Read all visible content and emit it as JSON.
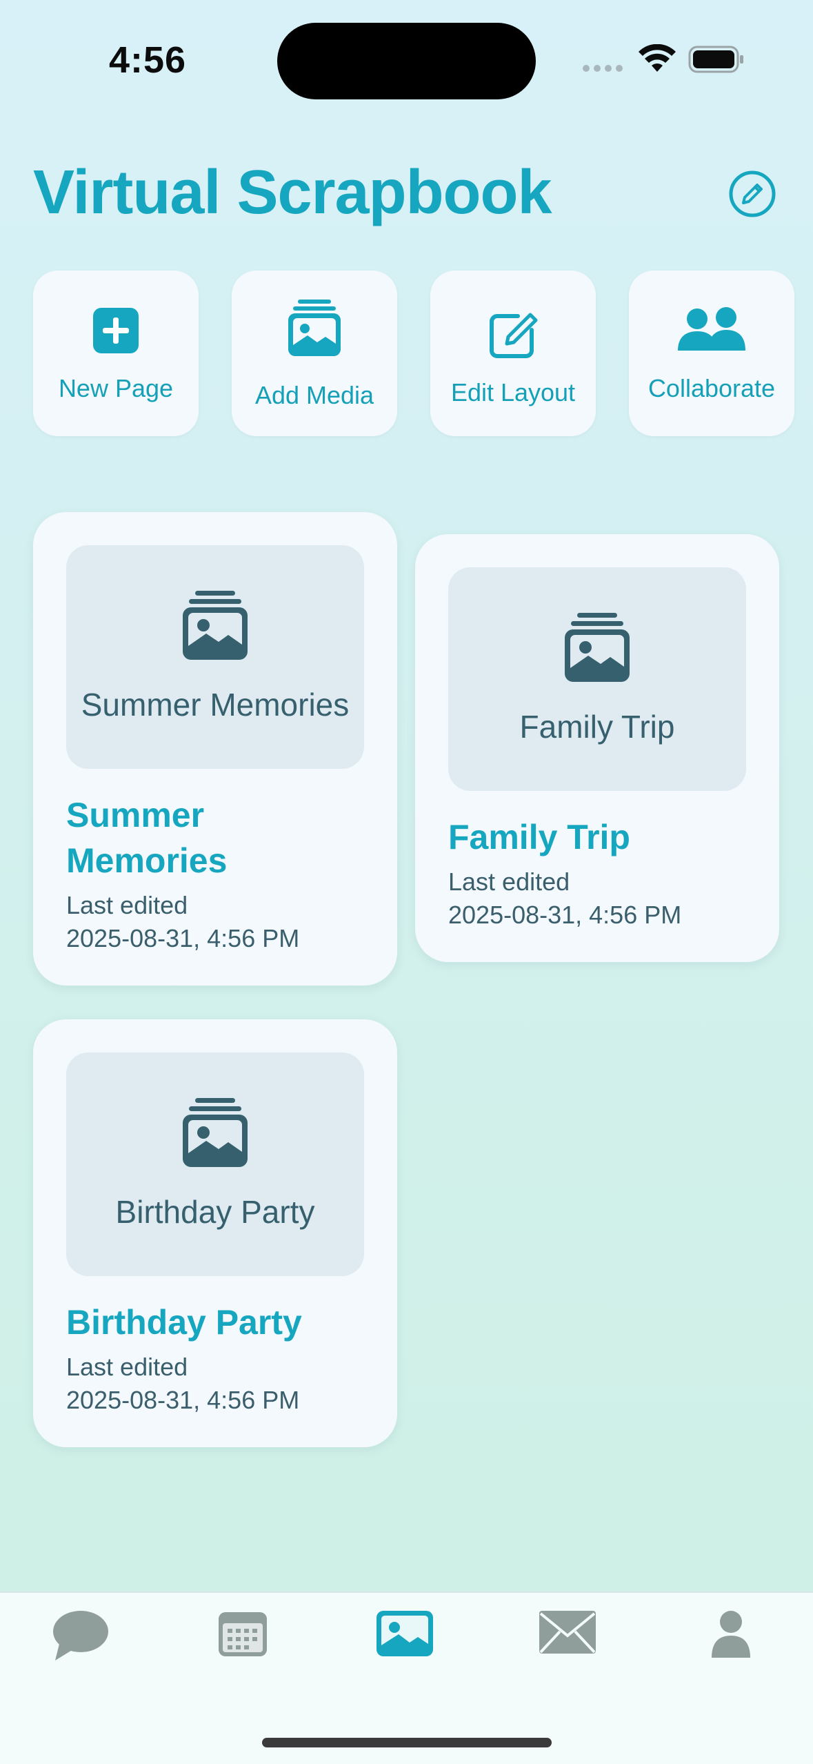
{
  "status": {
    "time": "4:56",
    "icons": [
      "cellular-icon",
      "wifi-icon",
      "battery-icon"
    ]
  },
  "header": {
    "title": "Virtual Scrapbook",
    "compose_icon": "pencil-circle-icon"
  },
  "actions": [
    {
      "label": "New Page",
      "icon": "plus-square-icon"
    },
    {
      "label": "Add Media",
      "icon": "photo-stack-icon"
    },
    {
      "label": "Edit Layout",
      "icon": "edit-square-icon"
    },
    {
      "label": "Collaborate",
      "icon": "people-icon"
    }
  ],
  "scrapbooks": [
    {
      "thumb_label": "Summer Memories",
      "title": "Summer Memories",
      "edited_label": "Last edited",
      "edited_date": "2025-08-31, 4:56 PM"
    },
    {
      "thumb_label": "Family Trip",
      "title": "Family Trip",
      "edited_label": "Last edited",
      "edited_date": "2025-08-31, 4:56 PM"
    },
    {
      "thumb_label": "Birthday Party",
      "title": "Birthday Party",
      "edited_label": "Last edited",
      "edited_date": "2025-08-31, 4:56 PM"
    }
  ],
  "tabs": [
    {
      "icon": "chat-bubble-icon",
      "active": false
    },
    {
      "icon": "calendar-icon",
      "active": false
    },
    {
      "icon": "photo-icon",
      "active": true
    },
    {
      "icon": "envelope-icon",
      "active": false
    },
    {
      "icon": "person-icon",
      "active": false
    }
  ],
  "colors": {
    "accent": "#16a6bf",
    "card": "#f3f9fd",
    "thumb": "#dfeaf1",
    "tab_inactive": "#8f9e9b"
  }
}
